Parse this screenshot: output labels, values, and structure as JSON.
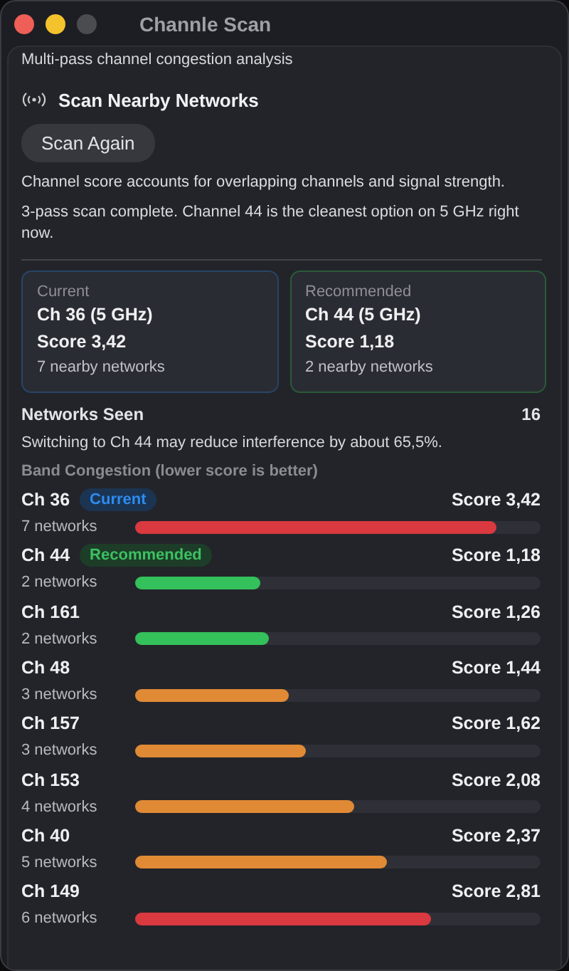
{
  "window": {
    "title": "Channle Scan"
  },
  "subtitle": "Multi-pass channel congestion analysis",
  "section_title": "Scan Nearby Networks",
  "scan_button": "Scan Again",
  "description": "Channel score accounts for overlapping channels and signal strength.",
  "status": "3-pass scan complete. Channel 44 is the cleanest option on 5 GHz right now.",
  "cards": [
    {
      "kind": "current",
      "label": "Current",
      "channel": "Ch 36 (5 GHz)",
      "score": "Score 3,42",
      "networks": "7 nearby networks"
    },
    {
      "kind": "recommended",
      "label": "Recommended",
      "channel": "Ch 44 (5 GHz)",
      "score": "Score 1,18",
      "networks": "2 nearby networks"
    }
  ],
  "networks_seen": {
    "label": "Networks Seen",
    "value": "16"
  },
  "advice": "Switching to Ch 44 may reduce interference by about 65,5%.",
  "congestion": {
    "title": "Band Congestion (lower score is better)",
    "rows": [
      {
        "channel": "Ch 36",
        "badge": {
          "kind": "current",
          "text": "Current"
        },
        "score": "Score 3,42",
        "networks": "7 networks",
        "level": 0.89,
        "color": "#d9393f"
      },
      {
        "channel": "Ch 44",
        "badge": {
          "kind": "recommended",
          "text": "Recommended"
        },
        "score": "Score 1,18",
        "networks": "2 networks",
        "level": 0.31,
        "color": "#34c05a"
      },
      {
        "channel": "Ch 161",
        "score": "Score 1,26",
        "networks": "2 networks",
        "level": 0.33,
        "color": "#34c05a"
      },
      {
        "channel": "Ch 48",
        "score": "Score 1,44",
        "networks": "3 networks",
        "level": 0.38,
        "color": "#e08a35"
      },
      {
        "channel": "Ch 157",
        "score": "Score 1,62",
        "networks": "3 networks",
        "level": 0.42,
        "color": "#e08a35"
      },
      {
        "channel": "Ch 153",
        "score": "Score 2,08",
        "networks": "4 networks",
        "level": 0.54,
        "color": "#e08a35"
      },
      {
        "channel": "Ch 40",
        "score": "Score 2,37",
        "networks": "5 networks",
        "level": 0.62,
        "color": "#e08a35"
      },
      {
        "channel": "Ch 149",
        "score": "Score 2,81",
        "networks": "6 networks",
        "level": 0.73,
        "color": "#d9393f"
      }
    ]
  }
}
